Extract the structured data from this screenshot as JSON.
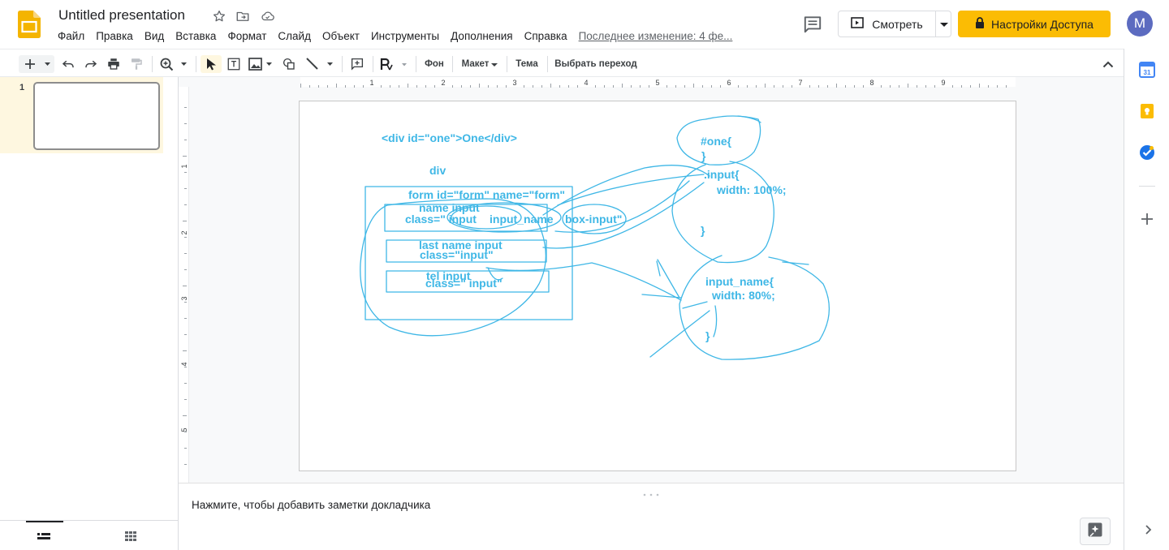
{
  "header": {
    "title": "Untitled presentation",
    "menu": [
      "Файл",
      "Правка",
      "Вид",
      "Вставка",
      "Формат",
      "Слайд",
      "Объект",
      "Инструменты",
      "Дополнения",
      "Справка"
    ],
    "last_edit": "Последнее изменение: 4 фе...",
    "present_label": "Смотреть",
    "share_label": "Настройки Доступа",
    "avatar_letter": "M",
    "accent_color": "#fbbc04"
  },
  "toolbar": {
    "background_label": "Фон",
    "layout_label": "Макет",
    "theme_label": "Тема",
    "transition_label": "Выбрать переход"
  },
  "rulers": {
    "h_ticks": [
      "1",
      "2",
      "3",
      "4",
      "5",
      "6",
      "7",
      "8",
      "9"
    ],
    "v_ticks": [
      "1",
      "2",
      "3",
      "4",
      "5"
    ]
  },
  "filmstrip": {
    "slide_number": "1"
  },
  "slide": {
    "sketch_color": "#3fb7e6",
    "texts": {
      "div_html": "<div id=\"one\">One</div>",
      "div": "div",
      "form": "form id=\"form\" name=\"form\"",
      "name_input": "name input",
      "class_input": "class=\" input",
      "input_name": "input_name",
      "box_input": "box-input\"",
      "last_name": "last name input",
      "class_input2": "class=\"input\"",
      "tel_input": "tel input",
      "class_input3": "class=\" input\"",
      "one_open": "#one{",
      "one_close": "}",
      "input_open": ".input{",
      "width100": "width: 100%;",
      "input_close": "}",
      "input_name_open": "input_name{",
      "width80": "width: 80%;",
      "input_name_close": "}"
    }
  },
  "notes": {
    "placeholder": "Нажмите, чтобы добавить заметки докладчика"
  }
}
